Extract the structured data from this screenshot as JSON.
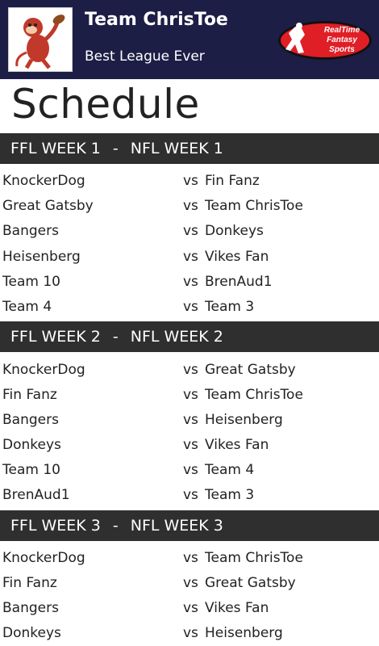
{
  "header": {
    "team_name": "Team ChrisToe",
    "league_name": "Best League Ever",
    "brand_logo_text": [
      "RealTime",
      "Fantasy",
      "Sports"
    ],
    "colors": {
      "header_bg": "#1d1e46",
      "brand_red": "#e01e26"
    }
  },
  "page": {
    "title": "Schedule"
  },
  "vs_label": "vs",
  "weeks": [
    {
      "ffl": "FFL WEEK 1",
      "sep": "-",
      "nfl": "NFL WEEK 1",
      "matchups": [
        {
          "home": "KnockerDog",
          "away": "Fin Fanz"
        },
        {
          "home": "Great Gatsby",
          "away": "Team ChrisToe"
        },
        {
          "home": "Bangers",
          "away": "Donkeys"
        },
        {
          "home": "Heisenberg",
          "away": "Vikes Fan"
        },
        {
          "home": "Team 10",
          "away": "BrenAud1"
        },
        {
          "home": "Team 4",
          "away": "Team 3"
        }
      ]
    },
    {
      "ffl": "FFL WEEK 2",
      "sep": "-",
      "nfl": "NFL WEEK 2",
      "matchups": [
        {
          "home": "KnockerDog",
          "away": "Great Gatsby"
        },
        {
          "home": "Fin Fanz",
          "away": "Team ChrisToe"
        },
        {
          "home": "Bangers",
          "away": "Heisenberg"
        },
        {
          "home": "Donkeys",
          "away": "Vikes Fan"
        },
        {
          "home": "Team 10",
          "away": "Team 4"
        },
        {
          "home": "BrenAud1",
          "away": "Team 3"
        }
      ]
    },
    {
      "ffl": "FFL WEEK 3",
      "sep": "-",
      "nfl": "NFL WEEK 3",
      "matchups": [
        {
          "home": "KnockerDog",
          "away": "Team ChrisToe"
        },
        {
          "home": "Fin Fanz",
          "away": "Great Gatsby"
        },
        {
          "home": "Bangers",
          "away": "Vikes Fan"
        },
        {
          "home": "Donkeys",
          "away": "Heisenberg"
        }
      ]
    }
  ]
}
